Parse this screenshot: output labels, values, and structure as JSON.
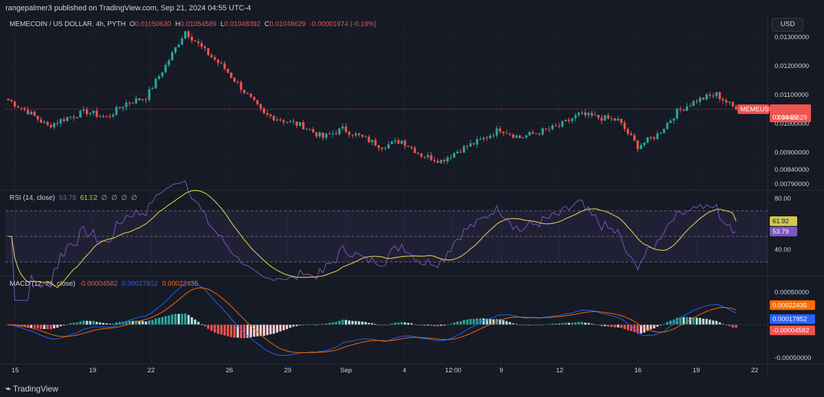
{
  "header": {
    "publisher": "rangepalmer3 published on TradingView.com, Sep 21, 2024 04:55 UTC-4"
  },
  "symbol": {
    "title": "MEMECOIN / US DOLLAR, 4h, PYTH",
    "o_label": "O",
    "o_value": "0.01050630",
    "h_label": "H",
    "h_value": "0.01054589",
    "l_label": "L",
    "l_value": "0.01048392",
    "c_label": "C",
    "c_value": "0.01048629",
    "change": "-0.00001974 (-0.19%)",
    "ticker_tag": "MEMEUSD",
    "price_tag": "0.01048629",
    "countdown": "03:04:22"
  },
  "currency_button": "USD",
  "price_axis": {
    "ticks": [
      "0.01300000",
      "0.01200000",
      "0.01100000",
      "0.01000000",
      "0.00900000",
      "0.00840000",
      "0.00790000"
    ]
  },
  "rsi": {
    "label": "RSI (14, close)",
    "value": "53.79",
    "ma_value": "61.92",
    "extras": [
      "∅",
      "∅",
      "∅",
      "∅"
    ],
    "ticks": [
      "80.00",
      "40.00"
    ]
  },
  "macd": {
    "label": "MACD (12, 26, close)",
    "hist_value": "-0.00004582",
    "macd_value": "0.00017852",
    "signal_value": "0.00022435",
    "ticks": [
      "0.00050000",
      "-0.00050000"
    ]
  },
  "time_axis": [
    "15",
    "19",
    "22",
    "26",
    "29",
    "Sep",
    "4",
    "12:00",
    "9",
    "12",
    "16",
    "19",
    "22"
  ],
  "footer": {
    "brand": "TradingView"
  },
  "colors": {
    "background": "#161a25",
    "up": "#26a69a",
    "down": "#ef5350",
    "rsi_line": "#7e57c2",
    "rsi_ma": "#d4c84a",
    "macd_line": "#2962ff",
    "signal_line": "#ff6d00"
  },
  "chart_data": {
    "type": "line",
    "description_series": [
      {
        "name": "MEMEUSD close",
        "points": [
          [
            "Aug 15",
            0.0108
          ],
          [
            "Aug 16",
            0.0104
          ],
          [
            "Aug 17",
            0.0099
          ],
          [
            "Aug 18",
            0.0102
          ],
          [
            "Aug 19",
            0.0104
          ],
          [
            "Aug 20",
            0.0102
          ],
          [
            "Aug 21",
            0.0107
          ],
          [
            "Aug 22",
            0.0109
          ],
          [
            "Aug 23",
            0.012
          ],
          [
            "Aug 24",
            0.0132
          ],
          [
            "Aug 25",
            0.0125
          ],
          [
            "Aug 26",
            0.0119
          ],
          [
            "Aug 27",
            0.0111
          ],
          [
            "Aug 28",
            0.0103
          ],
          [
            "Aug 29",
            0.0101
          ],
          [
            "Aug 30",
            0.0099
          ],
          [
            "Aug 31",
            0.0095
          ],
          [
            "Sep 1",
            0.0098
          ],
          [
            "Sep 2",
            0.0095
          ],
          [
            "Sep 3",
            0.0092
          ],
          [
            "Sep 4",
            0.0094
          ],
          [
            "Sep 5",
            0.0089
          ],
          [
            "Sep 6",
            0.0087
          ],
          [
            "Sep 7",
            0.0091
          ],
          [
            "Sep 8",
            0.0094
          ],
          [
            "Sep 9",
            0.0098
          ],
          [
            "Sep 10",
            0.0095
          ],
          [
            "Sep 11",
            0.0097
          ],
          [
            "Sep 12",
            0.0099
          ],
          [
            "Sep 13",
            0.0103
          ],
          [
            "Sep 14",
            0.0102
          ],
          [
            "Sep 15",
            0.0101
          ],
          [
            "Sep 16",
            0.0092
          ],
          [
            "Sep 17",
            0.0096
          ],
          [
            "Sep 18",
            0.0104
          ],
          [
            "Sep 19",
            0.0108
          ],
          [
            "Sep 20",
            0.011
          ],
          [
            "Sep 21",
            0.01048629
          ]
        ]
      }
    ],
    "series": [
      {
        "name": "RSI (14, close)",
        "last": 53.79
      },
      {
        "name": "RSI MA",
        "last": 61.92
      },
      {
        "name": "MACD",
        "last": 0.00017852
      },
      {
        "name": "Signal",
        "last": 0.00022435
      },
      {
        "name": "Histogram",
        "last": -4.582e-05
      }
    ],
    "price_range": [
      0.0077,
      0.0137
    ],
    "rsi_range": [
      20,
      85
    ],
    "rsi_bands": [
      30,
      50,
      70
    ],
    "macd_range": [
      -0.00058,
      0.00072
    ]
  }
}
